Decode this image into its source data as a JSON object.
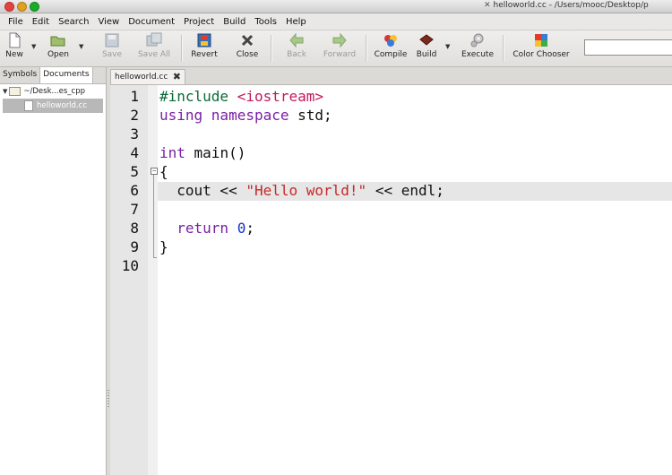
{
  "window": {
    "title": "helloworld.cc - /Users/mooc/Desktop/p"
  },
  "menu": [
    "File",
    "Edit",
    "Search",
    "View",
    "Document",
    "Project",
    "Build",
    "Tools",
    "Help"
  ],
  "toolbar": {
    "new": "New",
    "open": "Open",
    "save": "Save",
    "save_all": "Save All",
    "revert": "Revert",
    "close": "Close",
    "back": "Back",
    "forward": "Forward",
    "compile": "Compile",
    "build": "Build",
    "execute": "Execute",
    "color_chooser": "Color Chooser"
  },
  "sidebar": {
    "tabs": [
      "Symbols",
      "Documents"
    ],
    "folder": "~/Desk...es_cpp",
    "file": "helloworld.cc"
  },
  "editor": {
    "tab_label": "helloworld.cc",
    "line_numbers": [
      "1",
      "2",
      "3",
      "4",
      "5",
      "6",
      "7",
      "8",
      "9",
      "10"
    ],
    "lines": {
      "l1_directive": "#include",
      "l1_header": " <iostream>",
      "l2_kw": "using namespace",
      "l2_rest": " std;",
      "l4_type": "int",
      "l4_rest": " main()",
      "l5": "{",
      "l6_pre": "  cout << ",
      "l6_str": "\"Hello world!\"",
      "l6_post": " << endl;",
      "l8_kw": "  return",
      "l8_sp": " ",
      "l8_num": "0",
      "l8_end": ";",
      "l9": "}"
    },
    "current_line": 6
  }
}
